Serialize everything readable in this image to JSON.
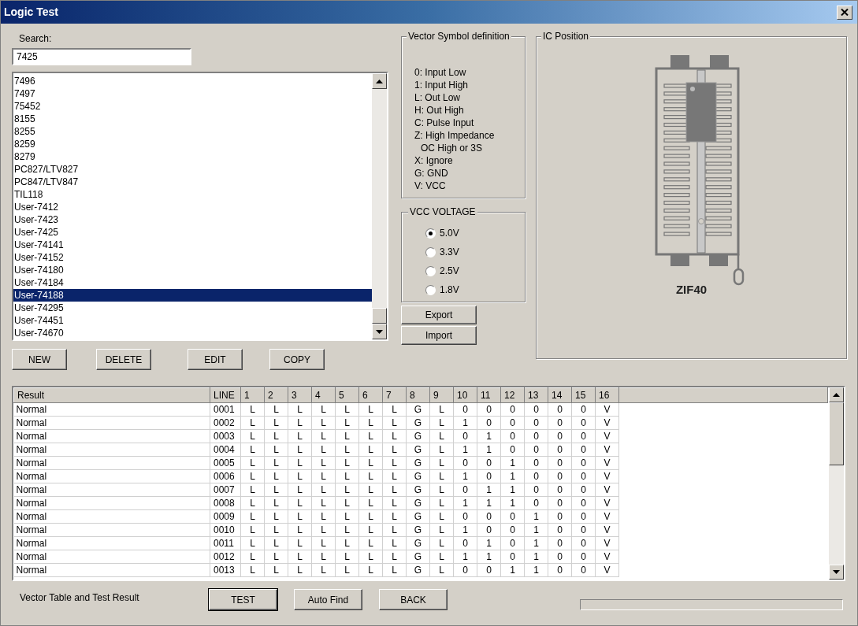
{
  "window": {
    "title": "Logic Test"
  },
  "search": {
    "label": "Search:",
    "value": "7425"
  },
  "devices": [
    {
      "name": "7496",
      "selected": false
    },
    {
      "name": "7497",
      "selected": false
    },
    {
      "name": "75452",
      "selected": false
    },
    {
      "name": "8155",
      "selected": false
    },
    {
      "name": "8255",
      "selected": false
    },
    {
      "name": "8259",
      "selected": false
    },
    {
      "name": "8279",
      "selected": false
    },
    {
      "name": "PC827/LTV827",
      "selected": false
    },
    {
      "name": "PC847/LTV847",
      "selected": false
    },
    {
      "name": "TIL118",
      "selected": false
    },
    {
      "name": "User-7412",
      "selected": false
    },
    {
      "name": "User-7423",
      "selected": false
    },
    {
      "name": "User-7425",
      "selected": false
    },
    {
      "name": "User-74141",
      "selected": false
    },
    {
      "name": "User-74152",
      "selected": false
    },
    {
      "name": "User-74180",
      "selected": false
    },
    {
      "name": "User-74184",
      "selected": false
    },
    {
      "name": "User-74188",
      "selected": true
    },
    {
      "name": "User-74295",
      "selected": false
    },
    {
      "name": "User-74451",
      "selected": false
    },
    {
      "name": "User-74670",
      "selected": false
    }
  ],
  "list_buttons": [
    "NEW",
    "DELETE",
    "EDIT",
    "COPY"
  ],
  "symbol_definition": {
    "title": "Vector Symbol definition",
    "lines": [
      {
        "text": "0: Input Low",
        "kind": "entry"
      },
      {
        "text": "1: Input High",
        "kind": "entry"
      },
      {
        "text": "L: Out Low",
        "kind": "entry"
      },
      {
        "text": "H: Out High",
        "kind": "entry"
      },
      {
        "text": "C: Pulse Input",
        "kind": "entry"
      },
      {
        "text": "Z: High Impedance",
        "kind": "entry"
      },
      {
        "text": "OC High or 3S",
        "kind": "continuation"
      },
      {
        "text": "X: Ignore",
        "kind": "entry"
      },
      {
        "text": "G: GND",
        "kind": "entry"
      },
      {
        "text": "V: VCC",
        "kind": "entry"
      }
    ]
  },
  "vcc_voltage": {
    "title": "VCC VOLTAGE",
    "options": [
      {
        "label": "5.0V",
        "selected": true
      },
      {
        "label": "3.3V",
        "selected": false
      },
      {
        "label": "2.5V",
        "selected": false
      },
      {
        "label": "1.8V",
        "selected": false
      }
    ]
  },
  "io_buttons": [
    "Export",
    "Import"
  ],
  "ic_position": {
    "title": "IC Position",
    "socket": "ZIF40"
  },
  "vector_table": {
    "columns": [
      "Result",
      "LINE",
      "1",
      "2",
      "3",
      "4",
      "5",
      "6",
      "7",
      "8",
      "9",
      "10",
      "11",
      "12",
      "13",
      "14",
      "15",
      "16"
    ],
    "rows": [
      {
        "result": "Normal",
        "line": "0001",
        "pins": [
          "L",
          "L",
          "L",
          "L",
          "L",
          "L",
          "L",
          "G",
          "L",
          "0",
          "0",
          "0",
          "0",
          "0",
          "0",
          "V"
        ]
      },
      {
        "result": "Normal",
        "line": "0002",
        "pins": [
          "L",
          "L",
          "L",
          "L",
          "L",
          "L",
          "L",
          "G",
          "L",
          "1",
          "0",
          "0",
          "0",
          "0",
          "0",
          "V"
        ]
      },
      {
        "result": "Normal",
        "line": "0003",
        "pins": [
          "L",
          "L",
          "L",
          "L",
          "L",
          "L",
          "L",
          "G",
          "L",
          "0",
          "1",
          "0",
          "0",
          "0",
          "0",
          "V"
        ]
      },
      {
        "result": "Normal",
        "line": "0004",
        "pins": [
          "L",
          "L",
          "L",
          "L",
          "L",
          "L",
          "L",
          "G",
          "L",
          "1",
          "1",
          "0",
          "0",
          "0",
          "0",
          "V"
        ]
      },
      {
        "result": "Normal",
        "line": "0005",
        "pins": [
          "L",
          "L",
          "L",
          "L",
          "L",
          "L",
          "L",
          "G",
          "L",
          "0",
          "0",
          "1",
          "0",
          "0",
          "0",
          "V"
        ]
      },
      {
        "result": "Normal",
        "line": "0006",
        "pins": [
          "L",
          "L",
          "L",
          "L",
          "L",
          "L",
          "L",
          "G",
          "L",
          "1",
          "0",
          "1",
          "0",
          "0",
          "0",
          "V"
        ]
      },
      {
        "result": "Normal",
        "line": "0007",
        "pins": [
          "L",
          "L",
          "L",
          "L",
          "L",
          "L",
          "L",
          "G",
          "L",
          "0",
          "1",
          "1",
          "0",
          "0",
          "0",
          "V"
        ]
      },
      {
        "result": "Normal",
        "line": "0008",
        "pins": [
          "L",
          "L",
          "L",
          "L",
          "L",
          "L",
          "L",
          "G",
          "L",
          "1",
          "1",
          "1",
          "0",
          "0",
          "0",
          "V"
        ]
      },
      {
        "result": "Normal",
        "line": "0009",
        "pins": [
          "L",
          "L",
          "L",
          "L",
          "L",
          "L",
          "L",
          "G",
          "L",
          "0",
          "0",
          "0",
          "1",
          "0",
          "0",
          "V"
        ]
      },
      {
        "result": "Normal",
        "line": "0010",
        "pins": [
          "L",
          "L",
          "L",
          "L",
          "L",
          "L",
          "L",
          "G",
          "L",
          "1",
          "0",
          "0",
          "1",
          "0",
          "0",
          "V"
        ]
      },
      {
        "result": "Normal",
        "line": "0011",
        "pins": [
          "L",
          "L",
          "L",
          "L",
          "L",
          "L",
          "L",
          "G",
          "L",
          "0",
          "1",
          "0",
          "1",
          "0",
          "0",
          "V"
        ]
      },
      {
        "result": "Normal",
        "line": "0012",
        "pins": [
          "L",
          "L",
          "L",
          "L",
          "L",
          "L",
          "L",
          "G",
          "L",
          "1",
          "1",
          "0",
          "1",
          "0",
          "0",
          "V"
        ]
      },
      {
        "result": "Normal",
        "line": "0013",
        "pins": [
          "L",
          "L",
          "L",
          "L",
          "L",
          "L",
          "L",
          "G",
          "L",
          "0",
          "0",
          "1",
          "1",
          "0",
          "0",
          "V"
        ]
      }
    ]
  },
  "progress": {
    "level": 0
  },
  "footer": {
    "label": "Vector Table and Test Result",
    "buttons": [
      {
        "label": "TEST",
        "default": true
      },
      {
        "label": "Auto Find",
        "default": false
      },
      {
        "label": "BACK",
        "default": false
      }
    ]
  }
}
